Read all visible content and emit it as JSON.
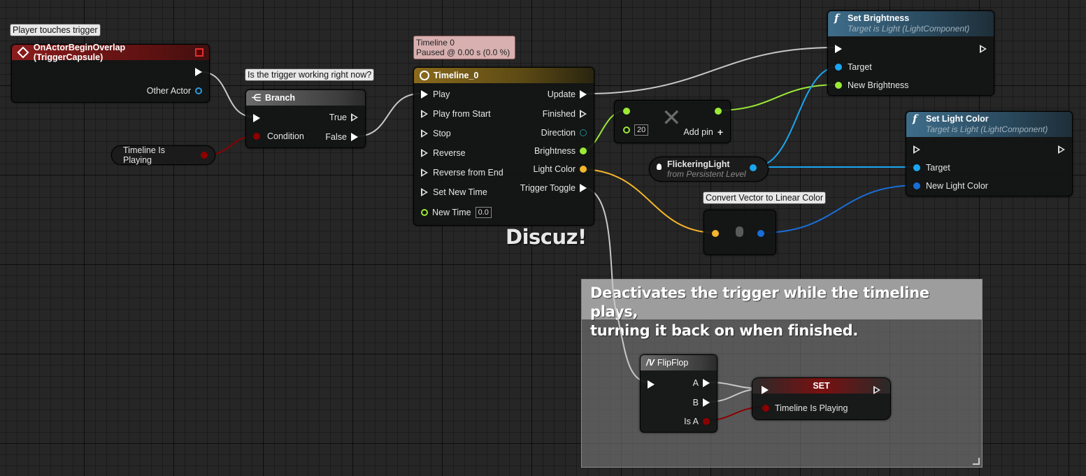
{
  "colors": {
    "exec": "#ffffff",
    "bool": "#8c0000",
    "object": "#2a9ae0",
    "float": "#9bea35",
    "vector": "#f4b62a",
    "linear_color": "#1a6dd6",
    "light_object": "#1aa6f0",
    "struct_dim": "#1a8a8a"
  },
  "icons": {
    "event": "event-diamond-icon",
    "branch": "branch-icon",
    "timeline": "clock-icon",
    "function": "function-f-icon",
    "flipflop": "flipflop-icon",
    "light": "lightbulb-icon",
    "add": "plus-icon",
    "multiply": "x-icon"
  },
  "event_node": {
    "tooltip": "Player touches trigger",
    "title": "OnActorBeginOverlap (TriggerCapsule)",
    "other_actor": "Other Actor"
  },
  "branch_node": {
    "tooltip": "Is the trigger working right now?",
    "title": "Branch",
    "true_label": "True",
    "false_label": "False",
    "condition_label": "Condition"
  },
  "var_timeline_playing": {
    "label": "Timeline Is Playing"
  },
  "timeline_node": {
    "status_title": "Timeline 0",
    "status_detail": "Paused @ 0.00 s (0.0 %)",
    "title": "Timeline_0",
    "inputs": [
      "Play",
      "Play from Start",
      "Stop",
      "Reverse",
      "Reverse from End",
      "Set New Time"
    ],
    "new_time_label": "New Time",
    "new_time_value": "0.0",
    "outputs": [
      "Update",
      "Finished",
      "Direction",
      "Brightness",
      "Light Color",
      "Trigger Toggle"
    ]
  },
  "multiply_node": {
    "value": "20",
    "add_pin": "Add pin"
  },
  "flickering_light": {
    "title": "FlickeringLight",
    "subtitle": "from Persistent Level"
  },
  "set_brightness": {
    "title": "Set Brightness",
    "subtitle": "Target is Light (LightComponent)",
    "target": "Target",
    "param": "New Brightness"
  },
  "set_light_color": {
    "title": "Set Light Color",
    "subtitle": "Target is Light (LightComponent)",
    "target": "Target",
    "param": "New Light Color"
  },
  "convert_node": {
    "tooltip": "Convert Vector to Linear Color"
  },
  "watermark": "Discuz!",
  "comment": {
    "text_line1": "Deactivates the trigger while the timeline plays,",
    "text_line2": "turning it back on when finished."
  },
  "flipflop_node": {
    "title": "FlipFlop",
    "a": "A",
    "b": "B",
    "is_a": "Is A"
  },
  "set_node": {
    "title": "SET",
    "var_label": "Timeline Is Playing"
  }
}
